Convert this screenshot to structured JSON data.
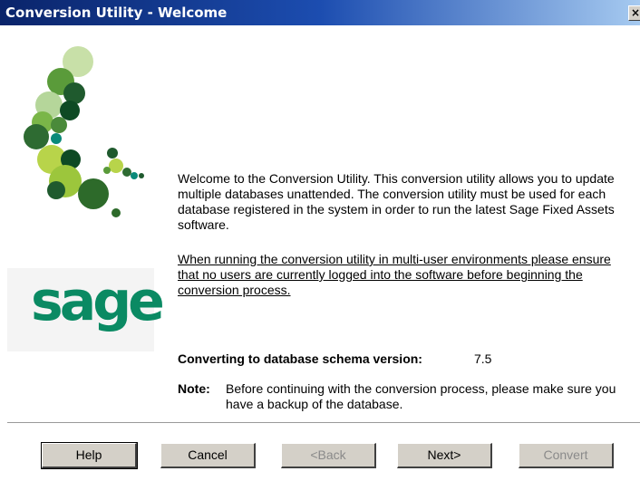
{
  "window": {
    "title": "Conversion Utility - Welcome",
    "close_glyph": "×"
  },
  "branding": {
    "logo_text": "sage",
    "logo_color": "#0a8a63",
    "art_icon": "leaf-cluster-graphic"
  },
  "main": {
    "welcome_text": "Welcome to the Conversion Utility. This conversion utility allows you to update multiple databases unattended. The conversion utility must be used for each database registered in the system in order to run the latest Sage Fixed Assets software.",
    "warning_text": "When running the conversion utility in multi-user environments please ensure that no users are currently logged into the software before beginning the conversion process.",
    "schema_label": "Converting to database schema version:",
    "schema_version": "7.5",
    "note_label": "Note:",
    "note_text": "Before continuing with the conversion process, please make sure you have a backup of the database."
  },
  "buttons": {
    "help": "Help",
    "cancel": "Cancel",
    "back": "<Back",
    "next": "Next>",
    "convert": "Convert"
  }
}
